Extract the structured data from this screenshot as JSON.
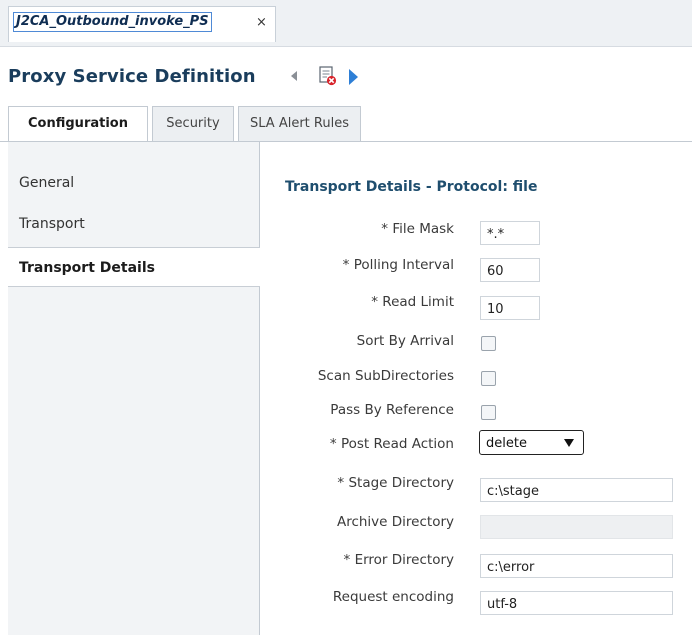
{
  "doc_tab": {
    "title": "J2CA_Outbound_invoke_PS",
    "close": "×"
  },
  "page": {
    "title": "Proxy Service Definition"
  },
  "icons": {
    "back": "nav-back-icon",
    "delete": "delete-icon",
    "forward": "nav-forward-icon"
  },
  "section_tabs": [
    {
      "label": "Configuration",
      "active": true
    },
    {
      "label": "Security",
      "active": false
    },
    {
      "label": "SLA Alert Rules",
      "active": false
    }
  ],
  "left_nav": [
    {
      "label": "General",
      "active": false
    },
    {
      "label": "Transport",
      "active": false
    },
    {
      "label": "Transport Details",
      "active": true
    }
  ],
  "details": {
    "heading": "Transport Details - Protocol: file",
    "file_mask": {
      "label": "* File Mask",
      "value": "*.*"
    },
    "polling_interval": {
      "label": "* Polling Interval",
      "value": "60"
    },
    "read_limit": {
      "label": "* Read Limit",
      "value": "10"
    },
    "sort_by_arrival": {
      "label": "Sort By Arrival",
      "checked": false
    },
    "scan_subdirectories": {
      "label": "Scan SubDirectories",
      "checked": false
    },
    "pass_by_reference": {
      "label": "Pass By Reference",
      "checked": false
    },
    "post_read_action": {
      "label": "* Post Read Action",
      "value": "delete"
    },
    "stage_directory": {
      "label": "* Stage Directory",
      "value": "c:\\stage"
    },
    "archive_directory": {
      "label": "Archive Directory",
      "value": ""
    },
    "error_directory": {
      "label": "* Error Directory",
      "value": "c:\\error"
    },
    "request_encoding": {
      "label": "Request encoding",
      "value": "utf-8"
    }
  },
  "colors": {
    "title": "#1a3d5c",
    "heading": "#1f4e6e",
    "forward_arrow": "#2e7fd6",
    "tab_border": "#4f8ad6"
  }
}
